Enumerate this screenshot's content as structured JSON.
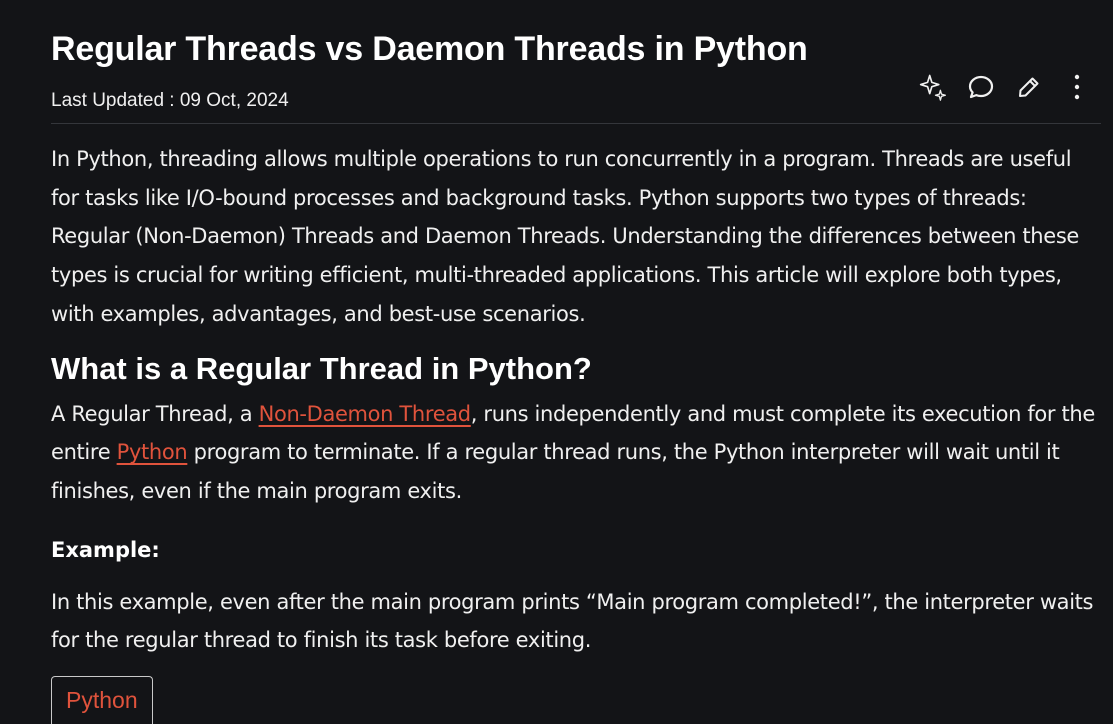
{
  "article": {
    "title": "Regular Threads vs Daemon Threads in Python",
    "last_updated": "Last Updated : 09 Oct, 2024",
    "intro": "In Python, threading allows multiple operations to run concurrently in a program. Threads are useful for tasks like I/O-bound processes and background tasks. Python supports two types of threads: Regular (Non-Daemon) Threads and Daemon Threads. Understanding the differences between these types is crucial for writing efficient, multi-threaded applications. This article will explore both types, with examples, advantages, and best-use scenarios.",
    "section_heading": "What is a Regular Thread in Python?",
    "section_para": {
      "part1": "A Regular Thread, a ",
      "link1": "Non-Daemon Thread",
      "part2": ", runs independently and must complete its execution for the entire ",
      "link2": "Python",
      "part3": " program to terminate. If a regular thread runs, the Python interpreter will wait until it finishes, even if the main program exits."
    },
    "example_label": "Example:",
    "example_text": "In this example, even after the main program prints “Main program completed!”, the interpreter waits for the regular thread to finish its task before exiting.",
    "code_tab_label": "Python"
  },
  "toolbar": {
    "icons": [
      "ai-sparkle-icon",
      "comment-icon",
      "edit-pencil-icon",
      "more-vertical-icon"
    ]
  },
  "colors": {
    "background": "#131417",
    "text": "#f0f0f0",
    "link": "#e0533c",
    "divider": "#34363b"
  }
}
